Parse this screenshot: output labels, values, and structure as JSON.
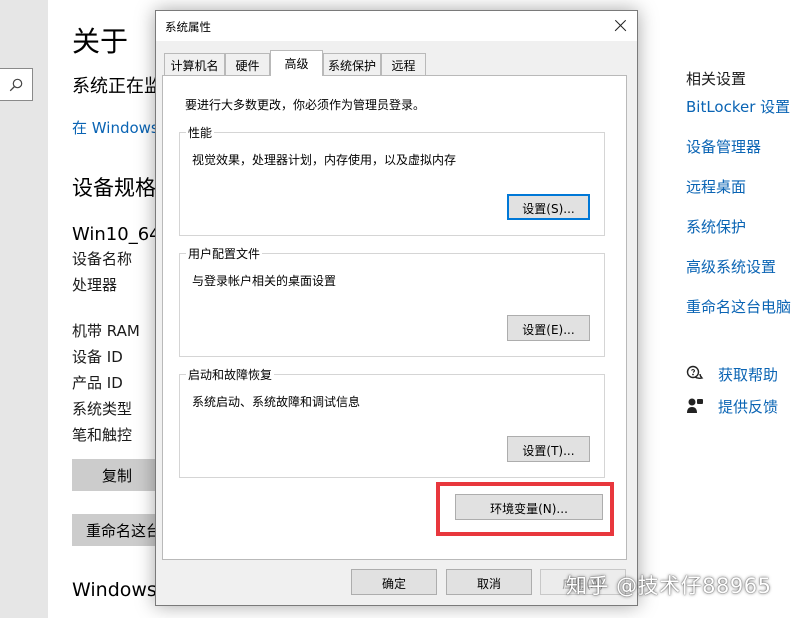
{
  "settings": {
    "title": "关于",
    "status": "系统正在监",
    "link": "在 Windows",
    "spec_heading": "设备规格",
    "device_name": "Win10_64",
    "labels": [
      "设备名称",
      "处理器",
      "机带 RAM",
      "设备 ID",
      "产品 ID",
      "系统类型",
      "笔和触控"
    ],
    "copy_button": "复制",
    "rename_button": "重命名这台",
    "windows_heading": "Windows",
    "related_heading": "相关设置",
    "related_links": [
      "BitLocker 设置",
      "设备管理器",
      "远程桌面",
      "系统保护",
      "高级系统设置",
      "重命名这台电脑"
    ],
    "help_links": [
      "获取帮助",
      "提供反馈"
    ],
    "watermark": "知乎 @技术仔88965"
  },
  "dialog": {
    "title": "系统属性",
    "tabs": [
      "计算机名",
      "硬件",
      "高级",
      "系统保护",
      "远程"
    ],
    "active_tab": "高级",
    "note": "要进行大多数更改，你必须作为管理员登录。",
    "groups": [
      {
        "title": "性能",
        "desc": "视觉效果，处理器计划，内存使用，以及虚拟内存",
        "button": "设置(S)..."
      },
      {
        "title": "用户配置文件",
        "desc": "与登录帐户相关的桌面设置",
        "button": "设置(E)..."
      },
      {
        "title": "启动和故障恢复",
        "desc": "系统启动、系统故障和调试信息",
        "button": "设置(T)..."
      }
    ],
    "env_button": "环境变量(N)...",
    "ok_button": "确定",
    "cancel_button": "取消",
    "apply_button": "应用(A)",
    "highlight_color": "#e8373d",
    "accent_color": "#0078d7",
    "link_color": "#0a64b4"
  }
}
